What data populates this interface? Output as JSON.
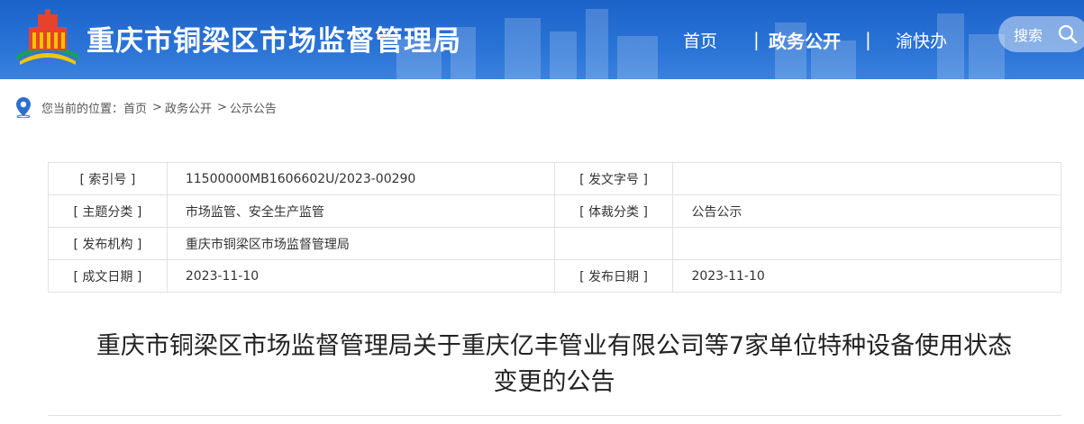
{
  "header": {
    "site_title": "重庆市铜梁区市场监督管理局",
    "nav": {
      "home": "首页",
      "sep": "|",
      "gov_affairs": "政务公开",
      "yukuaiban": "渝快办"
    },
    "search_label": "搜索"
  },
  "breadcrumb": {
    "prefix": "您当前的位置：",
    "items": [
      "首页",
      "政务公开",
      "公示公告"
    ],
    "separator": ">"
  },
  "meta": {
    "rows": [
      {
        "l1": "[ 索引号 ]",
        "v1": "11500000MB1606602U/2023-00290",
        "l2": "[ 发文字号 ]",
        "v2": ""
      },
      {
        "l1": "[ 主题分类 ]",
        "v1": "市场监管、安全生产监管",
        "l2": "[ 体裁分类 ]",
        "v2": "公告公示"
      },
      {
        "l1": "[ 发布机构 ]",
        "v1": "重庆市铜梁区市场监督管理局",
        "l2": "",
        "v2": ""
      },
      {
        "l1": "[ 成文日期 ]",
        "v1": "2023-11-10",
        "l2": "[ 发布日期 ]",
        "v2": "2023-11-10"
      }
    ]
  },
  "document": {
    "title_line1": "重庆市铜梁区市场监督管理局关于重庆亿丰管业有限公司等7家单位特种设备使用状态",
    "title_line2": "变更的公告"
  },
  "colors": {
    "header_blue": "#2a73d6",
    "location_icon": "#2d6fd1"
  },
  "icons": [
    "logo-emblem",
    "search-icon",
    "location-pin-icon"
  ]
}
